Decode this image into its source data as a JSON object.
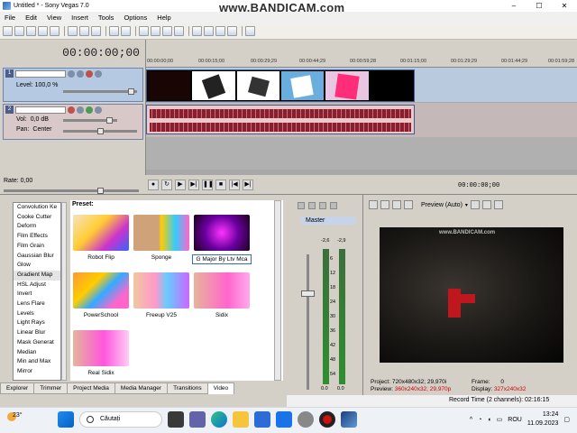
{
  "window": {
    "title": "Untitled * - Sony Vegas 7.0",
    "watermark": "www.BANDICAM.com",
    "controls": [
      "–",
      "☐",
      "✕"
    ]
  },
  "menu": [
    "File",
    "Edit",
    "View",
    "Insert",
    "Tools",
    "Options",
    "Help"
  ],
  "tracks": {
    "timecode": "00:00:00;00",
    "video_track": {
      "number": "1",
      "level_label": "Level: 100,0 %"
    },
    "audio_track": {
      "number": "2",
      "vol_label": "Vol:",
      "vol_value": "0,0 dB",
      "pan_label": "Pan:",
      "pan_value": "Center"
    }
  },
  "ruler_ticks": [
    "00:00:00;00",
    "00:00:15;00",
    "00:00:29;29",
    "00:00:44;29",
    "00:00:59;28",
    "00:01:15;00",
    "00:01:29;29",
    "00:01:44;29",
    "00:01:59;28"
  ],
  "transport": {
    "rate_label": "Rate: 0,00",
    "position": "00:00:00;00",
    "buttons": [
      "●",
      "↻",
      "▶",
      "▶|",
      "❚❚",
      "■",
      "|◀",
      "▶|"
    ]
  },
  "fx_list": [
    "Convolution Ke",
    "Cooke Cutter",
    "Deform",
    "Film Effects",
    "Film Grain",
    "Gaussian Blur",
    "Glow",
    "Gradient Map",
    "HSL Adjust",
    "Invert",
    "Lens Flare",
    "Levels",
    "Light Rays",
    "Linear Blur",
    "Mask Generat",
    "Median",
    "Min and Max",
    "Mirror"
  ],
  "preset_header": "Preset:",
  "presets": [
    {
      "name": "Robot Flip",
      "colors": "linear-gradient(135deg,#f5e3c0,#ffcc33 40%,#cc33cc 70%,#3366ff)"
    },
    {
      "name": "Sponge",
      "colors": "linear-gradient(90deg,#cfa27a 45%,#ffcc00 50%,#33ccff 75%,#ff66cc)"
    },
    {
      "name": "G Major By Ltv Mca",
      "colors": "radial-gradient(circle at 50% 50%,#ff33ff,#6a00a0 50%,#1a001a)"
    },
    {
      "name": "PowerSchool",
      "colors": "linear-gradient(135deg,#ff9933,#ffcc00 35%,#33aaff 55%,#ff66cc 80%)"
    },
    {
      "name": "Freeup V25",
      "colors": "linear-gradient(90deg,#f0c8a0,#ff99cc 40%,#66ccff 60%,#cc66ff)"
    },
    {
      "name": "Sidix",
      "colors": "linear-gradient(90deg,#e6b59a,#ff66cc 60%,#ffaaee)"
    },
    {
      "name": "Real Sidix",
      "colors": "linear-gradient(90deg,#e6b59a,#ff55dd 55%,#ffccf5)"
    }
  ],
  "tabs": [
    "Explorer",
    "Trimmer",
    "Project Media",
    "Media Manager",
    "Transitions",
    "Video"
  ],
  "mixer": {
    "label": "Master",
    "peak_left": "-2,6",
    "peak_right": "-2,9",
    "scale": [
      "6",
      "12",
      "18",
      "24",
      "30",
      "36",
      "42",
      "48",
      "54"
    ],
    "bottom_left": "0.0",
    "bottom_right": "0.0"
  },
  "preview": {
    "mode": "Preview (Auto)",
    "project_label": "Project:",
    "project_value": "720x480x32; 29,970i",
    "preview_label": "Preview:",
    "preview_value": "360x240x32; 29,970p",
    "frame_label": "Frame:",
    "frame_value": "0",
    "display_label": "Display:",
    "display_value": "327x240x32",
    "screen_watermark": "www.BANDICAM.com"
  },
  "status": "Record Time (2 channels): 02:16:15",
  "taskbar": {
    "temp": "23°",
    "search_placeholder": "Căutați",
    "lang": "ROU",
    "time": "13:24",
    "date": "11.09.2023"
  }
}
